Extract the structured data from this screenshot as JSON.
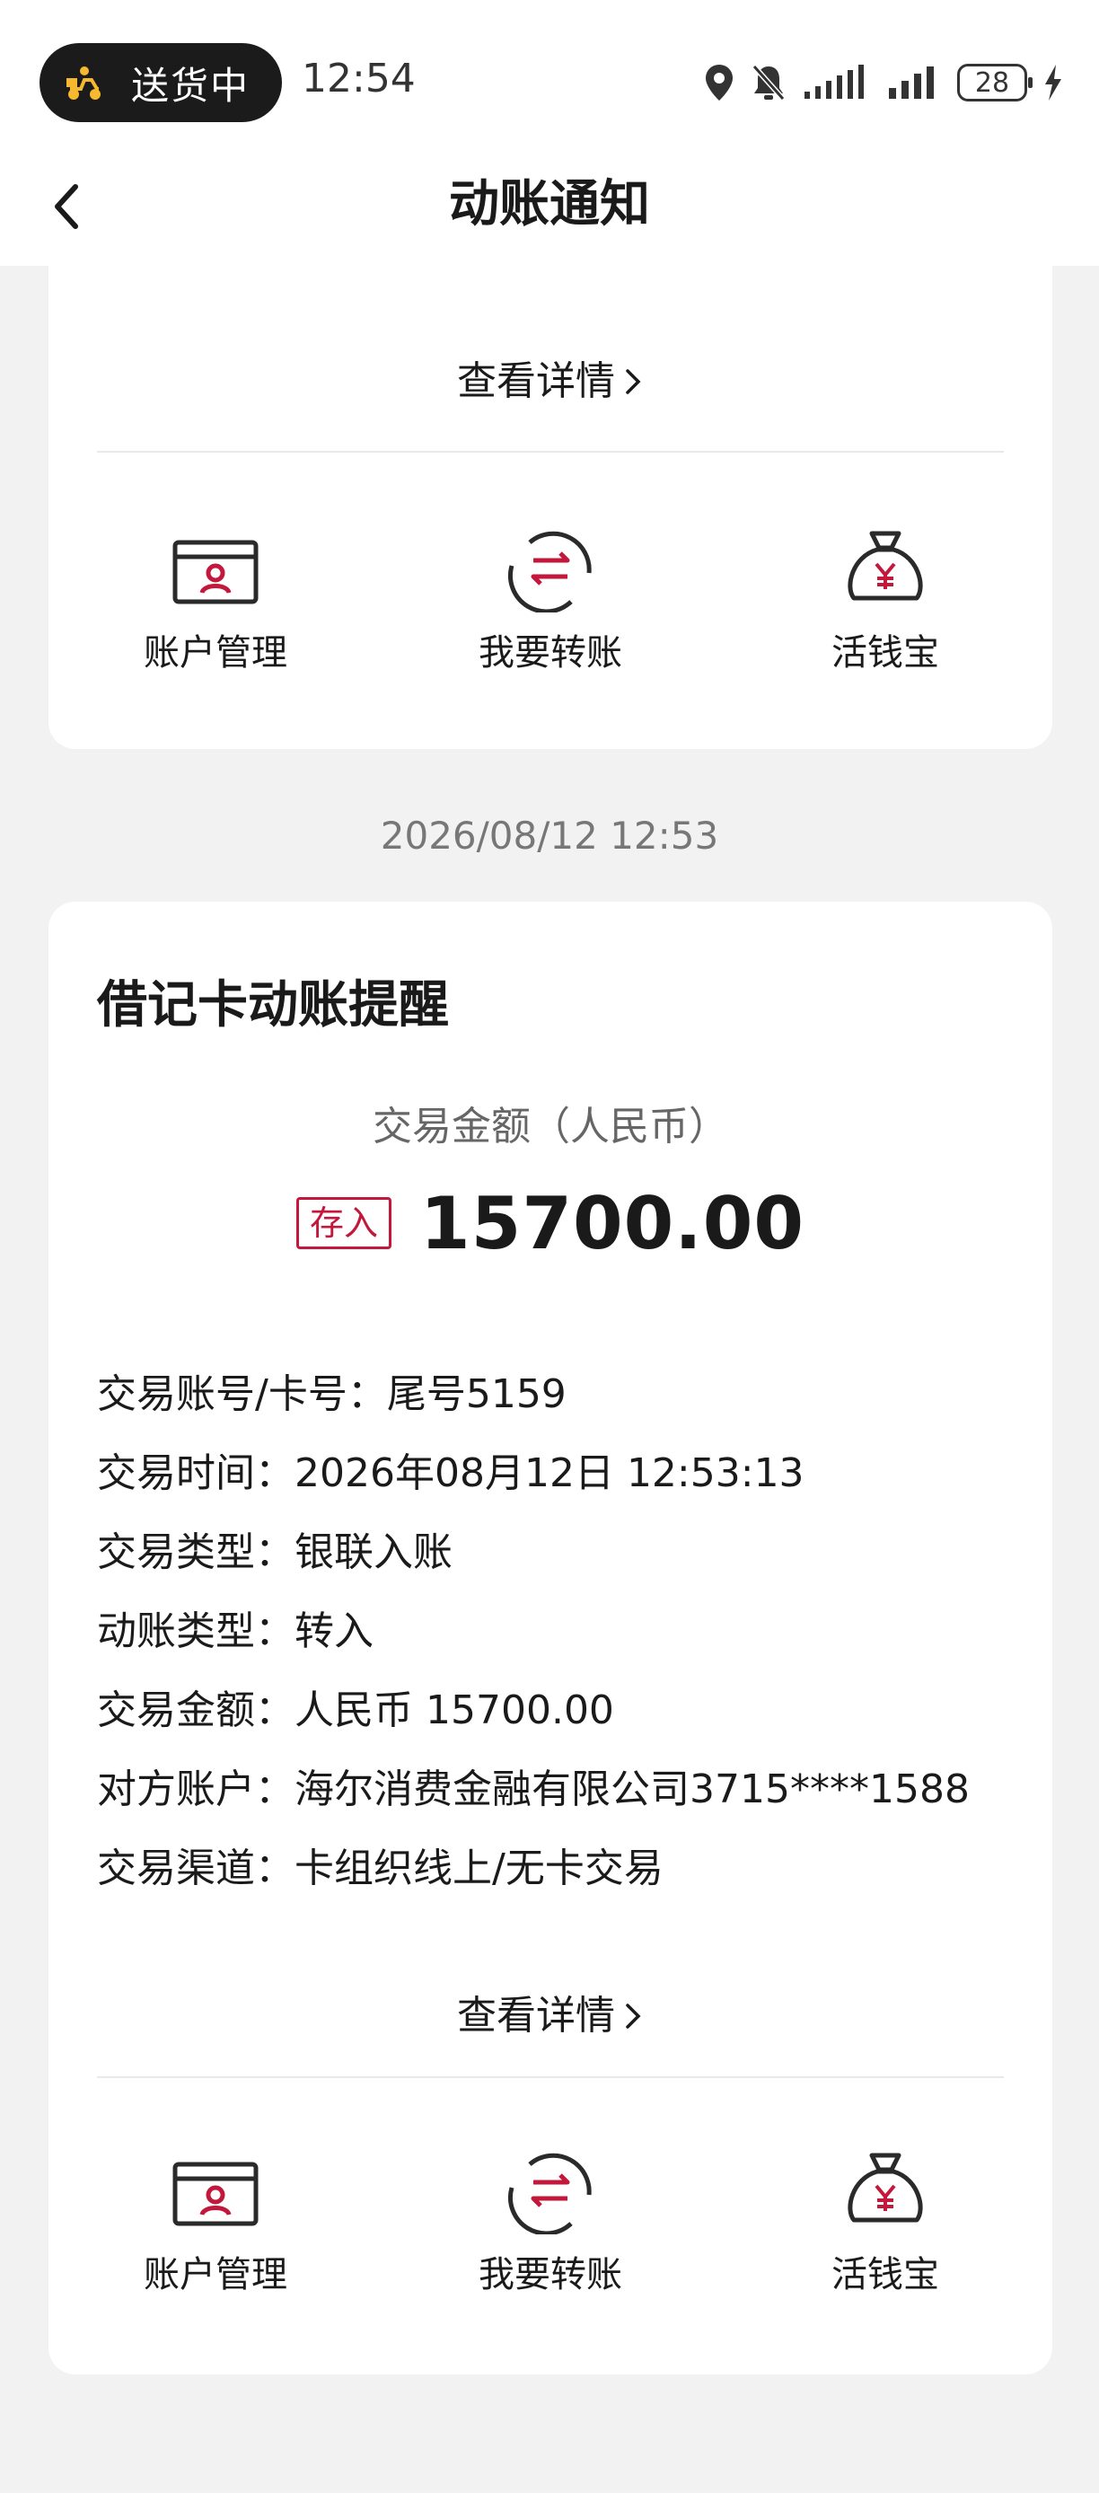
{
  "status_bar": {
    "pill_text": "送货中",
    "time": "12:54",
    "battery": "28"
  },
  "header": {
    "title": "动账通知"
  },
  "top_card": {
    "details_label": "查看详情",
    "quick_actions": [
      "账户管理",
      "我要转账",
      "活钱宝"
    ]
  },
  "timestamp": "2026/08/12 12:53",
  "main_card": {
    "title": "借记卡动账提醒",
    "amount_label": "交易金额（人民币）",
    "direction_tag": "存入",
    "amount": "15700.00",
    "details": [
      {
        "key": "交易账号/卡号：",
        "value": "尾号5159"
      },
      {
        "key": "交易时间：",
        "value": "2026年08月12日 12:53:13"
      },
      {
        "key": "交易类型：",
        "value": "银联入账"
      },
      {
        "key": "动账类型：",
        "value": "转入"
      },
      {
        "key": "交易金额：",
        "value": "人民币 15700.00"
      },
      {
        "key": "对方账户：",
        "value": "海尔消费金融有限公司3715****1588"
      },
      {
        "key": "交易渠道：",
        "value": "卡组织线上/无卡交易"
      }
    ],
    "details_label": "查看详情",
    "quick_actions": [
      "账户管理",
      "我要转账",
      "活钱宝"
    ]
  },
  "colors": {
    "accent": "#c3173b",
    "background": "#f2f2f2",
    "card": "#ffffff"
  }
}
